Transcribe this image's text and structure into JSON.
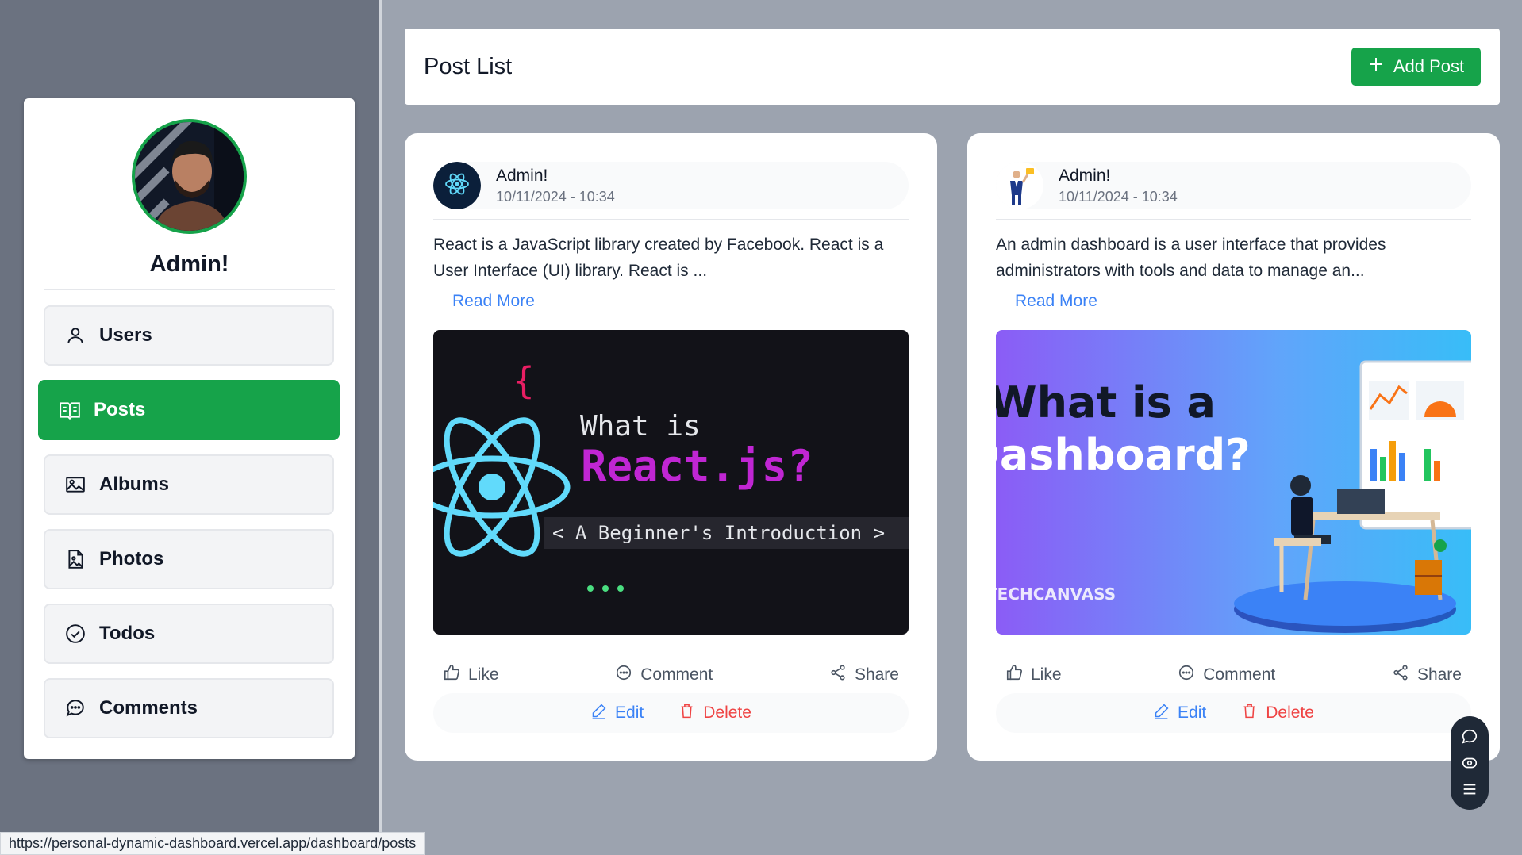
{
  "sidebar": {
    "admin_name": "Admin!",
    "items": [
      {
        "label": "Users",
        "icon": "user-icon",
        "active": false
      },
      {
        "label": "Posts",
        "icon": "book-icon",
        "active": true
      },
      {
        "label": "Albums",
        "icon": "image-icon",
        "active": false
      },
      {
        "label": "Photos",
        "icon": "file-image-icon",
        "active": false
      },
      {
        "label": "Todos",
        "icon": "check-circle-icon",
        "active": false
      },
      {
        "label": "Comments",
        "icon": "chat-icon",
        "active": false
      }
    ]
  },
  "header": {
    "title": "Post List",
    "add_label": "Add Post"
  },
  "posts": [
    {
      "author": "Admin!",
      "date": "10/11/2024 - 10:34",
      "body": "React is a JavaScript library created by Facebook. React is a User Interface (UI) library. React is ...",
      "read_more": "Read More",
      "image": {
        "line1": "What is",
        "line2": "React.js?",
        "line3": "< A Beginner's Introduction >"
      },
      "like": "Like",
      "comment": "Comment",
      "share": "Share",
      "edit": "Edit",
      "delete": "Delete"
    },
    {
      "author": "Admin!",
      "date": "10/11/2024 - 10:34",
      "body": "An admin dashboard is a user interface that provides administrators with tools and data to manage an...",
      "read_more": "Read More",
      "image": {
        "line1": "What is a",
        "line2": "Dashboard?",
        "brand": "TECHCANVASS"
      },
      "like": "Like",
      "comment": "Comment",
      "share": "Share",
      "edit": "Edit",
      "delete": "Delete"
    }
  ],
  "status_url": "https://personal-dynamic-dashboard.vercel.app/dashboard/posts",
  "colors": {
    "accent": "#16a34a",
    "link": "#3b82f6",
    "danger": "#ef4444"
  }
}
